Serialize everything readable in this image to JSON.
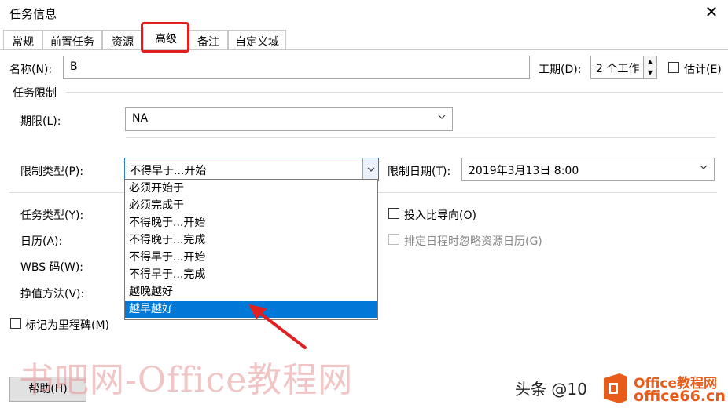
{
  "window": {
    "title": "任务信息"
  },
  "tabs": [
    {
      "label": "常规"
    },
    {
      "label": "前置任务"
    },
    {
      "label": "资源"
    },
    {
      "label": "高级"
    },
    {
      "label": "备注"
    },
    {
      "label": "自定义域"
    }
  ],
  "name": {
    "label": "名称(N):",
    "value": "B"
  },
  "duration": {
    "label": "工期(D):",
    "value": "2 个工作"
  },
  "estimated": {
    "label": "估计(E)"
  },
  "constraints": {
    "group_label": "任务限制",
    "deadline_label": "期限(L):",
    "deadline_value": "NA",
    "type_label": "限制类型(P):",
    "type_value": "不得早于...开始",
    "date_label": "限制日期(T):",
    "date_value": "2019年3月13日 8:00",
    "options": [
      "必须开始于",
      "必须完成于",
      "不得晚于...开始",
      "不得晚于...完成",
      "不得早于...开始",
      "不得早于...完成",
      "越晚越好",
      "越早越好"
    ],
    "highlighted_option": "越早越好"
  },
  "task_type": {
    "label": "任务类型(Y):"
  },
  "effort_driven": {
    "label": "投入比导向(O)"
  },
  "calendar": {
    "label": "日历(A):"
  },
  "ignore_resource_calendar": {
    "label": "排定日程时忽略资源日历(G)"
  },
  "wbs": {
    "label": "WBS 码(W):"
  },
  "earned_value": {
    "label": "挣值方法(V):"
  },
  "milestone": {
    "label": "标记为里程碑(M)"
  },
  "buttons": {
    "help": "帮助(H)"
  },
  "overlays": {
    "watermark": "书吧网-Office教程网",
    "toutiao": "头条 @10",
    "office_line1": "Office教程网",
    "office_line2": "office66.cn"
  },
  "colors": {
    "highlight_red": "#e02020",
    "selection_blue": "#0078d7",
    "office_orange": "#e85c1a"
  }
}
